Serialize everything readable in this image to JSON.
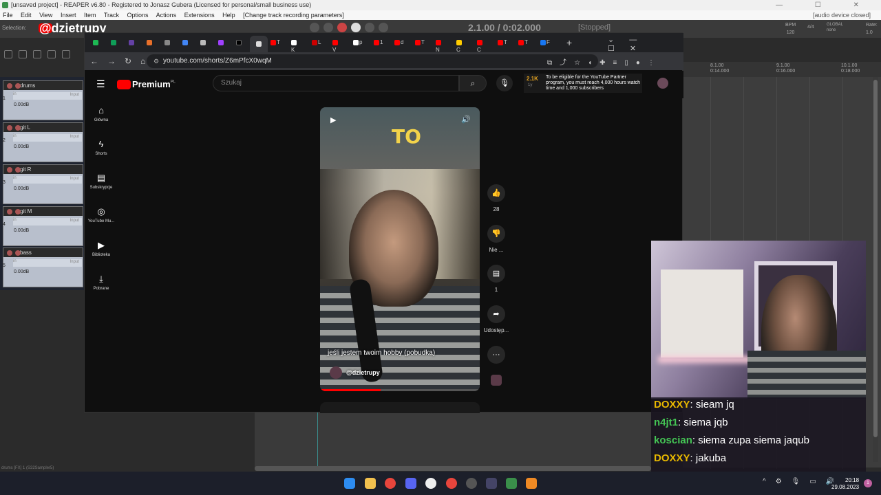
{
  "reaper": {
    "title": "[unsaved project] - REAPER v6.80 - Registered to Jonasz Gubera (Licensed for personal/small business use)",
    "menu": [
      "File",
      "Edit",
      "View",
      "Insert",
      "Item",
      "Track",
      "Options",
      "Actions",
      "Extensions",
      "Help",
      "[Change track recording parameters]"
    ],
    "audio_status": "[audio device closed]",
    "selection_label": "Selection:",
    "time_display": "2.1.00 / 0:02.000",
    "transport_status": "[Stopped]",
    "bpm_label": "BPM",
    "bpm_value": "120",
    "time_sig": "4/4",
    "global_label": "GLOBAL",
    "global_value": "none",
    "rate_label": "Rate:",
    "rate_value": "1.0",
    "ruler": [
      {
        "bar": "9.1.00",
        "time": "0:16.000"
      },
      {
        "bar": "10.1.00",
        "time": "0:18.000"
      },
      {
        "bar": "8.1.00",
        "time": "0:14.000"
      }
    ],
    "tracks": [
      {
        "num": "1",
        "name": "drums",
        "vol": "0.00dB",
        "input": "Input"
      },
      {
        "num": "2",
        "name": "git L",
        "vol": "0.00dB",
        "input": "Input"
      },
      {
        "num": "3",
        "name": "git R",
        "vol": "0.00dB",
        "input": "Input"
      },
      {
        "num": "4",
        "name": "git M",
        "vol": "0.00dB",
        "input": "Input"
      },
      {
        "num": "5",
        "name": "bass",
        "vol": "0.00dB",
        "input": "Input"
      }
    ],
    "bottom_status": "drums [FX] 1 (S32Sampler5)",
    "in_label": "in"
  },
  "overlay": {
    "handle": "@dzietrupy",
    "brand_color": "#ee0000"
  },
  "browser": {
    "url": "youtube.com/shorts/Z6mPfcX0wqM",
    "tabs": [
      "T",
      "K",
      "L",
      "V",
      "p",
      "1",
      "d",
      "T",
      "N",
      "C",
      "C",
      "T",
      "T",
      "F"
    ],
    "new_tab": "+",
    "window_controls": [
      "⌄",
      "—",
      "☐",
      "✕"
    ]
  },
  "youtube": {
    "logo_text": "Premium",
    "logo_region": "PL",
    "search_placeholder": "Szukaj",
    "subs_count": "2.1K",
    "subs_delta": "1y",
    "partner_text": "To be eligible for the YouTube Partner program, you must reach 4,000 hours watch time and 1,000 subscribers",
    "sidebar": [
      {
        "label": "Główna",
        "icon": "home-icon"
      },
      {
        "label": "Shorts",
        "icon": "shorts-icon"
      },
      {
        "label": "Subskrypcje",
        "icon": "subscriptions-icon"
      },
      {
        "label": "YouTube Mu...",
        "icon": "youtube-music-icon"
      },
      {
        "label": "Biblioteka",
        "icon": "library-icon"
      },
      {
        "label": "Pobrane",
        "icon": "download-icon"
      }
    ],
    "video": {
      "overlay_text": "TO",
      "caption": "jeśli jestem twoim hobby (pobudka)",
      "channel": "@dzietrupy",
      "progress": 0.38
    },
    "actions": {
      "likes": "28",
      "dislike_label": "Nie ...",
      "comments": "1",
      "share_label": "Udostęp...",
      "more": "···"
    }
  },
  "chat": [
    {
      "user": "DOXXY",
      "color": "#e8b800",
      "msg": "sieam jq"
    },
    {
      "user": "n4jt1",
      "color": "#44c454",
      "msg": "siema jqb"
    },
    {
      "user": "koscian",
      "color": "#44c454",
      "msg": "siema zupa siema jaqub"
    },
    {
      "user": "DOXXY",
      "color": "#e8b800",
      "msg": "jakuba"
    }
  ],
  "taskbar": {
    "time": "20:18",
    "date": "29.08.2023",
    "notifications": "1"
  }
}
